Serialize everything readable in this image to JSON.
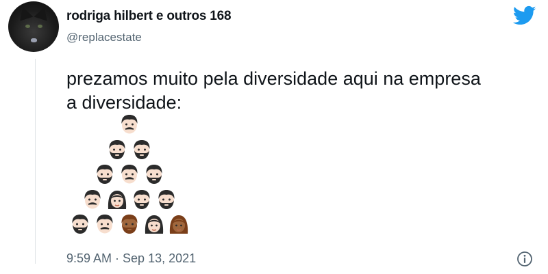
{
  "tweet": {
    "display_name": "rodriga hilbert e outros 168",
    "handle": "@replacestate",
    "text_line1": "prezamos muito pela diversidade aqui na empresa",
    "text_line2": "a diversidade:",
    "timestamp": "9:59 AM · Sep 13, 2021"
  },
  "icons": {
    "brand": "twitter-bird-icon",
    "info": "info-icon",
    "brand_color": "#1d9bf0"
  },
  "pyramid_rows": [
    [
      "man-mustache"
    ],
    [
      "man-beard",
      "man-beard"
    ],
    [
      "man-beard",
      "man-mustache",
      "man-beard"
    ],
    [
      "man-mustache",
      "woman",
      "man-beard",
      "man-beard"
    ],
    [
      "man-beard",
      "man-mustache",
      "man-dark",
      "woman",
      "woman-dark"
    ]
  ]
}
